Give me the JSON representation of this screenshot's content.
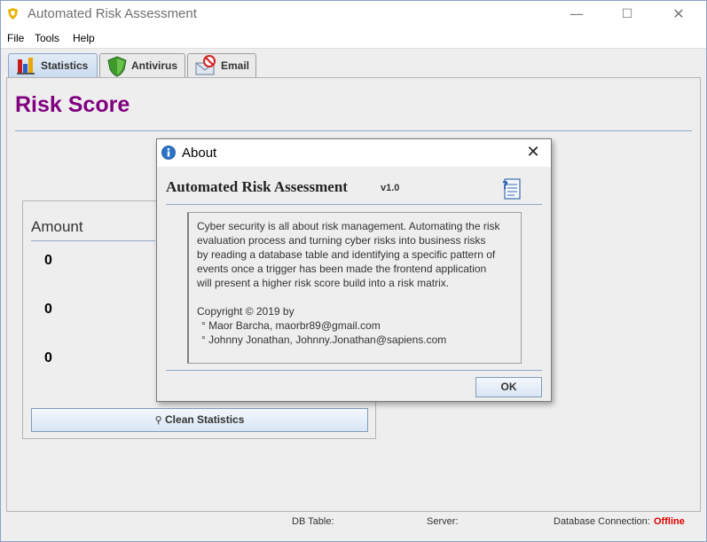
{
  "window": {
    "title": "Automated Risk Assessment",
    "controls": {
      "minimize": "—",
      "maximize": "☐",
      "close": "✕"
    }
  },
  "menu": [
    "File",
    "Tools",
    "Help"
  ],
  "tabs": [
    {
      "label": "Statistics",
      "icon": "bar-chart-icon",
      "active": true
    },
    {
      "label": "Antivirus",
      "icon": "shield-icon",
      "active": false
    },
    {
      "label": "Email",
      "icon": "email-icon",
      "active": false
    }
  ],
  "main": {
    "heading": "Risk Score",
    "heading_color": "#800080",
    "amount_label": "Amount",
    "amounts": [
      "0",
      "0",
      "0"
    ],
    "clean_button": "Clean Statistics"
  },
  "status": {
    "db_table_label": "DB Table:",
    "server_label": "Server:",
    "connection_label": "Database Connection:",
    "connection_value": "Offline",
    "connection_color": "#e00000"
  },
  "about": {
    "title": "About",
    "app_name": "Automated Risk Assessment",
    "version": "v1.0",
    "description_lines": [
      "Cyber security is all about risk management. Automating the risk",
      "evaluation process and turning cyber risks into business risks",
      "by reading a database table and identifying a specific pattern of",
      "events once a trigger has been made the frontend application",
      "will present a higher risk score build into a risk matrix."
    ],
    "copyright": "Copyright © 2019 by",
    "authors": [
      "° Maor Barcha, maorbr89@gmail.com",
      "° Johnny Jonathan, Johnny.Jonathan@sapiens.com"
    ],
    "ok_label": "OK"
  }
}
